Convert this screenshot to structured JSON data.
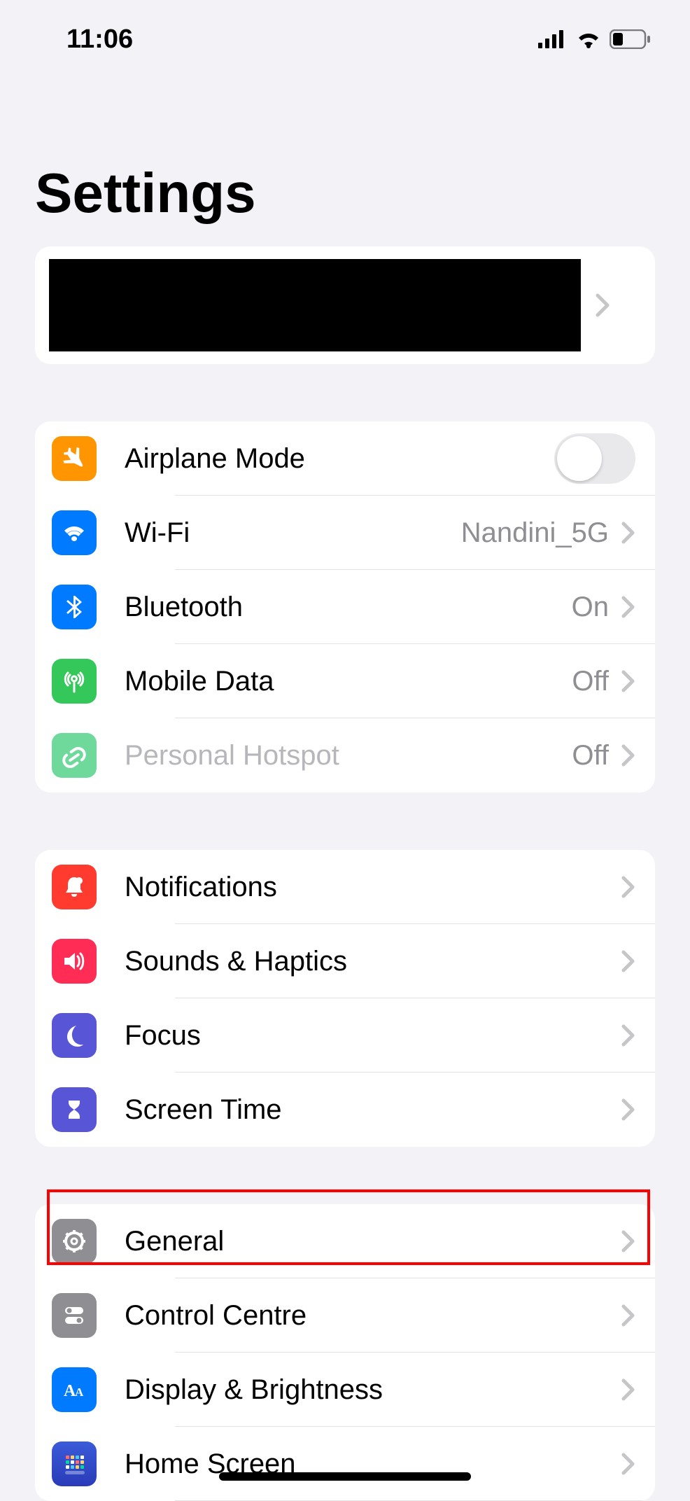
{
  "status": {
    "time": "11:06"
  },
  "title": "Settings",
  "group1": {
    "airplane": {
      "label": "Airplane Mode"
    },
    "wifi": {
      "label": "Wi-Fi",
      "value": "Nandini_5G"
    },
    "bluetooth": {
      "label": "Bluetooth",
      "value": "On"
    },
    "mobileData": {
      "label": "Mobile Data",
      "value": "Off"
    },
    "hotspot": {
      "label": "Personal Hotspot",
      "value": "Off"
    }
  },
  "group2": {
    "notifications": {
      "label": "Notifications"
    },
    "sounds": {
      "label": "Sounds & Haptics"
    },
    "focus": {
      "label": "Focus"
    },
    "screenTime": {
      "label": "Screen Time"
    }
  },
  "group3": {
    "general": {
      "label": "General"
    },
    "controlCentre": {
      "label": "Control Centre"
    },
    "display": {
      "label": "Display & Brightness"
    },
    "homeScreen": {
      "label": "Home Screen"
    }
  }
}
